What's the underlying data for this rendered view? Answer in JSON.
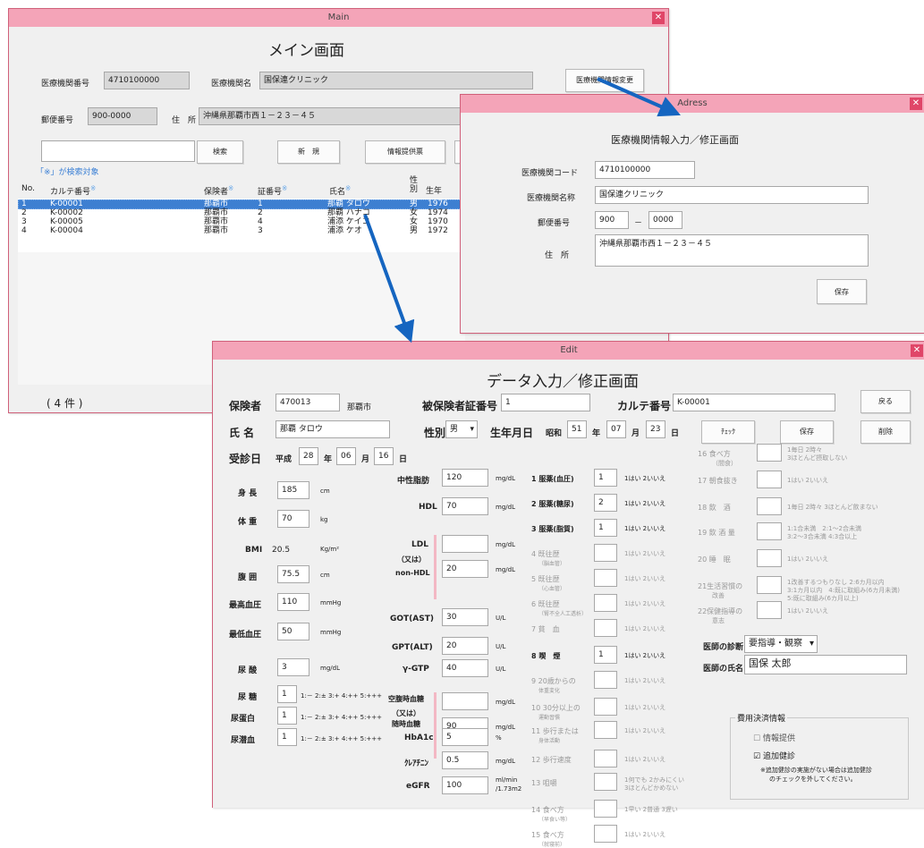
{
  "main": {
    "window_title": "Main",
    "heading": "メイン画面",
    "clinic_no_label": "医療機関番号",
    "clinic_no": "4710100000",
    "clinic_name_label": "医療機関名",
    "clinic_name": "国保連クリニック",
    "change_btn": "医療機関情報変更",
    "postal_label": "郵便番号",
    "postal": "900-0000",
    "address_label": "住　所",
    "address": "沖縄県那覇市西１－２３－４５",
    "search_value": "",
    "search_btn": "検索",
    "new_btn": "新　規",
    "info_btn": "情報提供票",
    "search_note": "「※」が検索対象",
    "columns": {
      "no": "No.",
      "karte": "カルテ番号",
      "karte_mark": "※",
      "insurer": "保険者",
      "insurer_mark": "※",
      "cert": "証番号",
      "cert_mark": "※",
      "name": "氏名",
      "name_mark": "※",
      "sex": "性別",
      "birth": "生年"
    },
    "rows": [
      {
        "no": "1",
        "karte": "K-00001",
        "insurer": "那覇市",
        "cert": "1",
        "name": "那覇 タロウ",
        "sex": "男",
        "birth": "1976"
      },
      {
        "no": "2",
        "karte": "K-00002",
        "insurer": "那覇市",
        "cert": "2",
        "name": "那覇 ハナコ",
        "sex": "女",
        "birth": "1974"
      },
      {
        "no": "3",
        "karte": "K-00005",
        "insurer": "那覇市",
        "cert": "4",
        "name": "浦添 ケイコ",
        "sex": "女",
        "birth": "1970"
      },
      {
        "no": "4",
        "karte": "K-00004",
        "insurer": "那覇市",
        "cert": "3",
        "name": "浦添 ケオ",
        "sex": "男",
        "birth": "1972"
      }
    ],
    "count": "( 4 件 )"
  },
  "address_win": {
    "window_title": "Adress",
    "heading": "医療機関情報入力／修正画面",
    "code_label": "医療機関コード",
    "code": "4710100000",
    "name_label": "医療機関名称",
    "name": "国保連クリニック",
    "postal_label": "郵便番号",
    "postal1": "900",
    "postal_dash": "－",
    "postal2": "0000",
    "address_label": "住　所",
    "address": "沖縄県那覇市西１－２３－４５",
    "save_btn": "保存"
  },
  "edit": {
    "window_title": "Edit",
    "heading": "データ入力／修正画面",
    "insurer_label": "保険者",
    "insurer_code": "470013",
    "insurer_name": "那覇市",
    "cert_label": "被保険者証番号",
    "cert_value": "1",
    "karte_label": "カルテ番号",
    "karte_value": "K-00001",
    "back_btn": "戻る",
    "name_label": "氏 名",
    "name_value": "那覇 タロウ",
    "sex_label": "性別",
    "sex_value": "男",
    "birth_label": "生年月日",
    "birth_era": "昭和",
    "birth_year": "51",
    "birth_month": "07",
    "birth_day": "23",
    "year_unit": "年",
    "month_unit": "月",
    "day_unit": "日",
    "check_btn": "ﾁｪｯｸ",
    "save_btn": "保存",
    "delete_btn": "削除",
    "exam_label": "受診日",
    "exam_era": "平成",
    "exam_year": "28",
    "exam_month": "06",
    "exam_day": "16",
    "body": {
      "height": {
        "label": "身 長",
        "value": "185",
        "unit": "cm"
      },
      "weight": {
        "label": "体 重",
        "value": "70",
        "unit": "kg"
      },
      "bmi": {
        "label": "BMI",
        "value": "20.5",
        "unit": "Kg/m²"
      },
      "waist": {
        "label": "腹 囲",
        "value": "75.5",
        "unit": "cm"
      },
      "bp_high": {
        "label": "最高血圧",
        "value": "110",
        "unit": "mmHg"
      },
      "bp_low": {
        "label": "最低血圧",
        "value": "50",
        "unit": "mmHg"
      },
      "uric": {
        "label": "尿 酸",
        "value": "3",
        "unit": "mg/dL"
      },
      "urine_sugar": {
        "label": "尿 糖",
        "value": "1",
        "scale": "1:－ 2:± 3:+ 4:++ 5:+++"
      },
      "urine_protein": {
        "label": "尿蛋白",
        "value": "1",
        "scale": "1:－ 2:± 3:+ 4:++ 5:+++"
      },
      "urine_blood": {
        "label": "尿潜血",
        "value": "1",
        "scale": "1:－ 2:± 3:+ 4:++ 5:+++"
      }
    },
    "lab": {
      "tg": {
        "label": "中性脂肪",
        "value": "120",
        "unit": "mg/dL"
      },
      "hdl": {
        "label": "HDL",
        "value": "70",
        "unit": "mg/dL"
      },
      "ldl": {
        "label": "LDL",
        "value": "",
        "unit": "mg/dL"
      },
      "or1": "（又は）",
      "nonhdl": {
        "label": "non-HDL",
        "value": "20",
        "unit": "mg/dL"
      },
      "got": {
        "label": "GOT(AST)",
        "value": "30",
        "unit": "U/L"
      },
      "gpt": {
        "label": "GPT(ALT)",
        "value": "20",
        "unit": "U/L"
      },
      "ggtp": {
        "label": "γ-GTP",
        "value": "40",
        "unit": "U/L"
      },
      "fbs": {
        "label": "空腹時血糖",
        "value": "",
        "unit": "mg/dL"
      },
      "or2": "（又は）",
      "rbs": {
        "label": "随時血糖",
        "value": "90",
        "unit": "mg/dL"
      },
      "hba1c": {
        "label": "HbA1c",
        "value": "5",
        "unit": "%"
      },
      "cre": {
        "label": "ｸﾚｱﾁﾆﾝ",
        "value": "0.5",
        "unit": "mg/dL"
      },
      "egfr": {
        "label": "eGFR",
        "value": "100",
        "unit1": "ml/min",
        "unit2": "/1.73m2"
      }
    },
    "questions": [
      {
        "label": "1 服薬(血圧)",
        "sub": "",
        "value": "1",
        "opts": "1はい 2いいえ",
        "active": true
      },
      {
        "label": "2 服薬(糖尿)",
        "sub": "",
        "value": "2",
        "opts": "1はい 2いいえ",
        "active": true
      },
      {
        "label": "3 服薬(脂質)",
        "sub": "",
        "value": "1",
        "opts": "1はい 2いいえ",
        "active": true
      },
      {
        "label": "4 既往歴",
        "sub": "（脳血管）",
        "value": "",
        "opts": "1はい 2いいえ",
        "active": false
      },
      {
        "label": "5 既往歴",
        "sub": "（心血管）",
        "value": "",
        "opts": "1はい 2いいえ",
        "active": false
      },
      {
        "label": "6 既往歴",
        "sub": "（腎不全人工透析）",
        "value": "",
        "opts": "1はい 2いいえ",
        "active": false
      },
      {
        "label": "7 貧　血",
        "sub": "",
        "value": "",
        "opts": "1はい 2いいえ",
        "active": false
      },
      {
        "label": "8 喫　煙",
        "sub": "",
        "value": "1",
        "opts": "1はい 2いいえ",
        "active": true
      },
      {
        "label": "9 20歳からの",
        "sub": "体重変化",
        "value": "",
        "opts": "1はい 2いいえ",
        "active": false
      },
      {
        "label": "10 30分以上の",
        "sub": "運動習慣",
        "value": "",
        "opts": "1はい 2いいえ",
        "active": false
      },
      {
        "label": "11 歩行または",
        "sub": "身体活動",
        "value": "",
        "opts": "1はい 2いいえ",
        "active": false
      },
      {
        "label": "12 歩行速度",
        "sub": "",
        "value": "",
        "opts": "1はい 2いいえ",
        "active": false
      },
      {
        "label": "13 咀嚼",
        "sub": "",
        "value": "",
        "opts": "1何でも 2かみにくい",
        "opts2": "3ほとんどかめない",
        "active": false
      },
      {
        "label": "14 食べ方",
        "sub": "（早食い等）",
        "value": "",
        "opts": "1早い 2普通 3遅い",
        "active": false
      },
      {
        "label": "15 食べ方",
        "sub": "（就寝前）",
        "value": "",
        "opts": "1はい 2いいえ",
        "active": false
      }
    ],
    "questions2": [
      {
        "label": "16 食べ方",
        "sub": "（間食）",
        "opts": "1毎日 2時々",
        "opts2": "3ほとんど摂取しない"
      },
      {
        "label": "17 朝食抜き",
        "sub": "",
        "opts": "1はい 2いいえ",
        "opts2": ""
      },
      {
        "label": "18 飲　酒",
        "sub": "",
        "opts": "1毎日 2時々 3ほとんど飲まない",
        "opts2": ""
      },
      {
        "label": "19 飲 酒 量",
        "sub": "",
        "opts": "1:1合未満　2:1～2合未満",
        "opts2": "3:2～3合未満 4:3合以上"
      },
      {
        "label": "20 睡　眠",
        "sub": "",
        "opts": "1はい 2いいえ",
        "opts2": ""
      },
      {
        "label": "21生活習慣の",
        "sub": "改善",
        "opts": "1改善するつもりなし 2:6カ月以内",
        "opts2": "3:1カ月以内　4:既に取組み(6カ月未満)",
        "opts3": "5:既に取組み(6カ月以上)"
      },
      {
        "label": "22保健指導の",
        "sub": "意志",
        "opts": "1はい 2いいえ",
        "opts2": ""
      }
    ],
    "doctor_diag_label": "医師の診断",
    "doctor_diag": "要指導・観察",
    "doctor_name_label": "医師の氏名",
    "doctor_name": "国保 太郎",
    "fee_group_label": "費用決済情報",
    "info_provide": "情報提供",
    "extra_exam": "追加健診",
    "extra_note1": "※追加健診の実施がない場合は追加健診",
    "extra_note2": "のチェックを外してください。"
  },
  "colors": {
    "title_pink": "#f4a4b8",
    "close_red": "#e04668",
    "arrow_blue": "#1565c0",
    "select_blue": "#3d7fd1"
  }
}
